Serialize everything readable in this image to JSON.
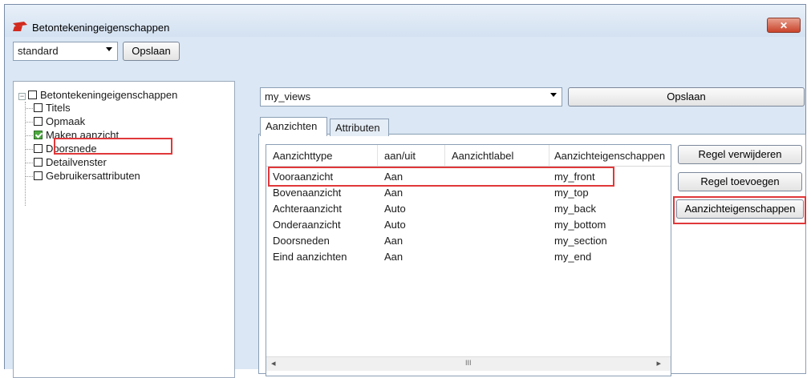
{
  "window": {
    "title": "Betontekeningeigenschappen",
    "close_glyph": "✕"
  },
  "toolbar": {
    "profile_value": "standard",
    "save_label": "Opslaan"
  },
  "tree": {
    "root": "Betontekeningeigenschappen",
    "items": [
      {
        "label": "Titels",
        "checked": false
      },
      {
        "label": "Opmaak",
        "checked": false
      },
      {
        "label": "Maken aanzicht",
        "checked": true
      },
      {
        "label": "Doorsnede",
        "checked": false
      },
      {
        "label": "Detailvenster",
        "checked": false
      },
      {
        "label": "Gebruikersattributen",
        "checked": false
      }
    ]
  },
  "views": {
    "select_value": "my_views",
    "save_label": "Opslaan"
  },
  "tabs": [
    {
      "label": "Aanzichten",
      "active": true
    },
    {
      "label": "Attributen",
      "active": false
    }
  ],
  "table": {
    "headers": [
      "Aanzichttype",
      "aan/uit",
      "Aanzichtlabel",
      "Aanzichteigenschappen"
    ],
    "rows": [
      [
        "Vooraanzicht",
        "Aan",
        "",
        "my_front"
      ],
      [
        "Bovenaanzicht",
        "Aan",
        "",
        "my_top"
      ],
      [
        "Achteraanzicht",
        "Auto",
        "",
        "my_back"
      ],
      [
        "Onderaanzicht",
        "Auto",
        "",
        "my_bottom"
      ],
      [
        "Doorsneden",
        "Aan",
        "",
        "my_section"
      ],
      [
        "Eind aanzichten",
        "Aan",
        "",
        "my_end"
      ]
    ],
    "scroll_thumb_glyph": "III"
  },
  "actions": {
    "remove_row": "Regel verwijderen",
    "add_row": "Regel toevoegen",
    "view_properties": "Aanzichteigenschappen"
  },
  "colors": {
    "highlight": "#e0383a",
    "checked_green": "#4caa3e",
    "window_bg": "#dbe7f4"
  }
}
